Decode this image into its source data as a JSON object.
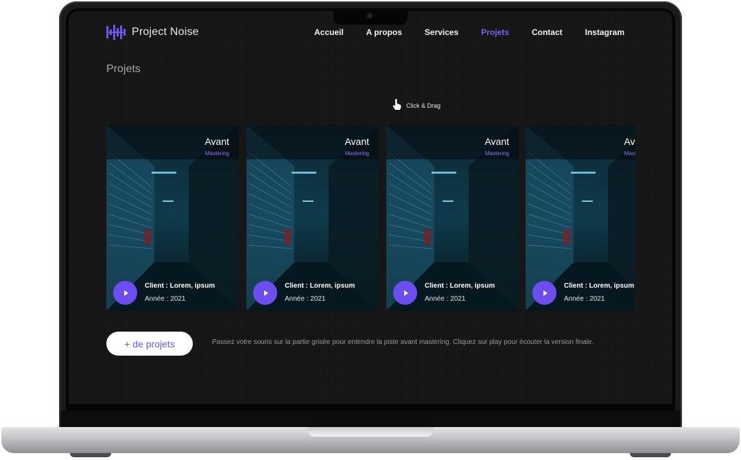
{
  "brand": {
    "name": "Project Noise",
    "accent": "#7b63f0"
  },
  "nav": {
    "items": [
      {
        "label": "Accueil"
      },
      {
        "label": "A propos"
      },
      {
        "label": "Services"
      },
      {
        "label": "Projets",
        "active": true
      },
      {
        "label": "Contact"
      },
      {
        "label": "Instagram"
      }
    ]
  },
  "page": {
    "title": "Projets"
  },
  "drag_hint": {
    "icon": "pointer-hand-icon",
    "label": "Click & Drag"
  },
  "cards": [
    {
      "title": "Avant",
      "subtitle": "Mastering",
      "client": "Client : Lorem, ipsum",
      "year": "Année : 2021"
    },
    {
      "title": "Avant",
      "subtitle": "Mastering",
      "client": "Client : Lorem, ipsum",
      "year": "Année : 2021"
    },
    {
      "title": "Avant",
      "subtitle": "Mastering",
      "client": "Client : Lorem, ipsum",
      "year": "Année : 2021"
    },
    {
      "title": "Avant",
      "subtitle": "Mastering",
      "client": "Client : Lorem, ipsum",
      "year": "Année : 2021"
    }
  ],
  "more_button": {
    "label": "+ de projets"
  },
  "info_text": "Passez votre souris sur la partie grisée pour entendre la piste avant mastering. Cliquez sur play pour écouter la version finale."
}
